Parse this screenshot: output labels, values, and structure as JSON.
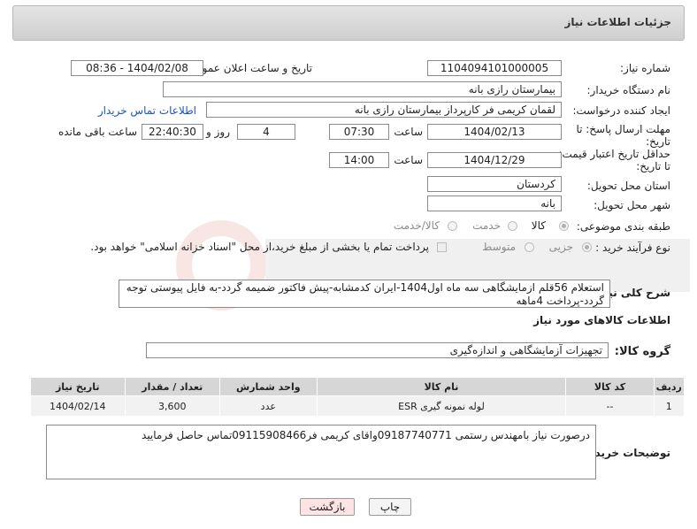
{
  "header": {
    "title": "جزئیات اطلاعات نیاز"
  },
  "form": {
    "need_number_label": "شماره نیاز:",
    "need_number": "1104094101000005",
    "announce_label": "تاریخ و ساعت اعلان عمومی:",
    "announce_value": "1404/02/08 - 08:36",
    "buyer_org_label": "نام دستگاه خریدار:",
    "buyer_org": "بیمارستان رازی بانه",
    "requester_label": "ایجاد کننده درخواست:",
    "requester": "لقمان کریمی فر کارپرداز بیمارستان رازی بانه",
    "contact_link": "اطلاعات تماس خریدار",
    "deadline_label_1": "مهلت ارسال پاسخ: تا",
    "deadline_label_2": "تاریخ:",
    "deadline_date": "1404/02/13",
    "time_label": "ساعت",
    "deadline_time": "07:30",
    "days_value": "4",
    "days_label": "روز و",
    "remaining_time": "22:40:30",
    "remaining_label": "ساعت باقی مانده",
    "validity_label_1": "حداقل تاریخ اعتبار قیمت:",
    "validity_label_2": "تا تاریخ:",
    "validity_date": "1404/12/29",
    "validity_time_label": "ساعت",
    "validity_time": "14:00",
    "province_label": "استان محل تحویل:",
    "province": "کردستان",
    "city_label": "شهر محل تحویل:",
    "city": "بانه",
    "category_label": "طبقه بندی موضوعی:",
    "category_options": [
      "کالا",
      "خدمت",
      "کالا/خدمت"
    ],
    "process_label": "نوع فرآیند خرید :",
    "process_options": [
      "جزیی",
      "متوسط"
    ],
    "payment_note": "پرداخت تمام یا بخشی از مبلغ خرید،از محل \"اسناد خزانه اسلامی\" خواهد بود.",
    "description_label": "شرح کلی نیاز:",
    "description": "استعلام 56قلم ازمایشگاهی سه ماه اول1404-ایران کدمشابه-پیش فاکتور ضمیمه گردد-به فایل پیوستی توجه گردد-پرداخت 4ماهه",
    "goods_section_title": "اطلاعات کالاهای مورد نیاز",
    "goods_group_label": "گروه کالا:",
    "goods_group": "تجهیزات آزمایشگاهی و اندازه‌گیری",
    "buyer_notes_label": "توضیحات خریدار:",
    "buyer_notes": "درصورت نیاز بامهندس رستمی 09187740771واقای کریمی فر09115908466تماس حاصل فرمایید"
  },
  "table": {
    "headers": [
      "ردیف",
      "کد کالا",
      "نام کالا",
      "واحد شمارش",
      "تعداد / مقدار",
      "تاریخ نیاز"
    ],
    "rows": [
      [
        "1",
        "--",
        "لوله نمونه گیری ESR",
        "عدد",
        "3,600",
        "1404/02/14"
      ]
    ]
  },
  "buttons": {
    "print": "چاپ",
    "back": "بازگشت"
  },
  "colors": {
    "link": "#1a56b8",
    "header_bg": "#d6d6d6",
    "back_button_bg": "#fde4e4"
  }
}
